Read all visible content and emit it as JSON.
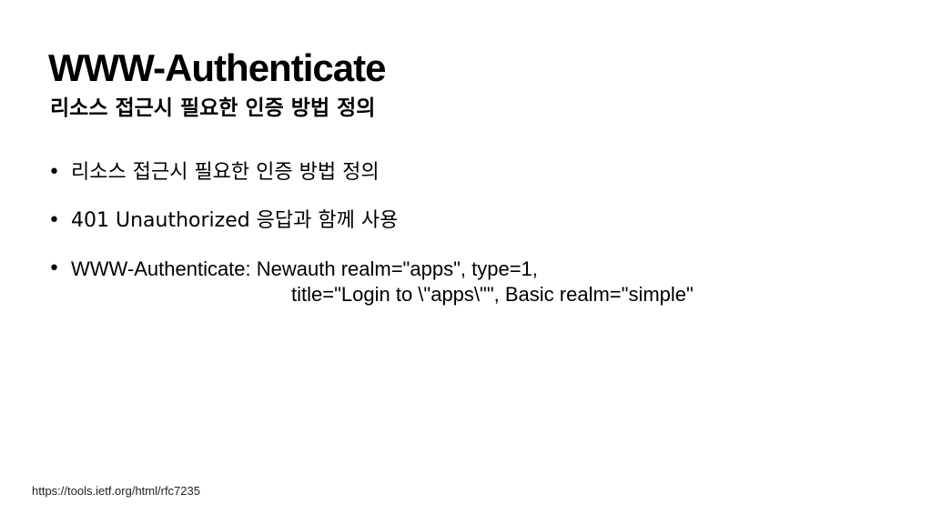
{
  "slide": {
    "title": "WWW-Authenticate",
    "subtitle": "리소스 접근시 필요한 인증 방법 정의",
    "bullet_marker": "•",
    "bullets": [
      {
        "text": "리소스 접근시 필요한 인증 방법 정의"
      },
      {
        "text": "401 Unauthorized 응답과 함께 사용"
      },
      {
        "line1": "WWW-Authenticate: Newauth realm=\"apps\", type=1,",
        "line2": "title=\"Login to \\\"apps\\\"\", Basic realm=\"simple\""
      }
    ],
    "footer_url": "https://tools.ietf.org/html/rfc7235"
  }
}
